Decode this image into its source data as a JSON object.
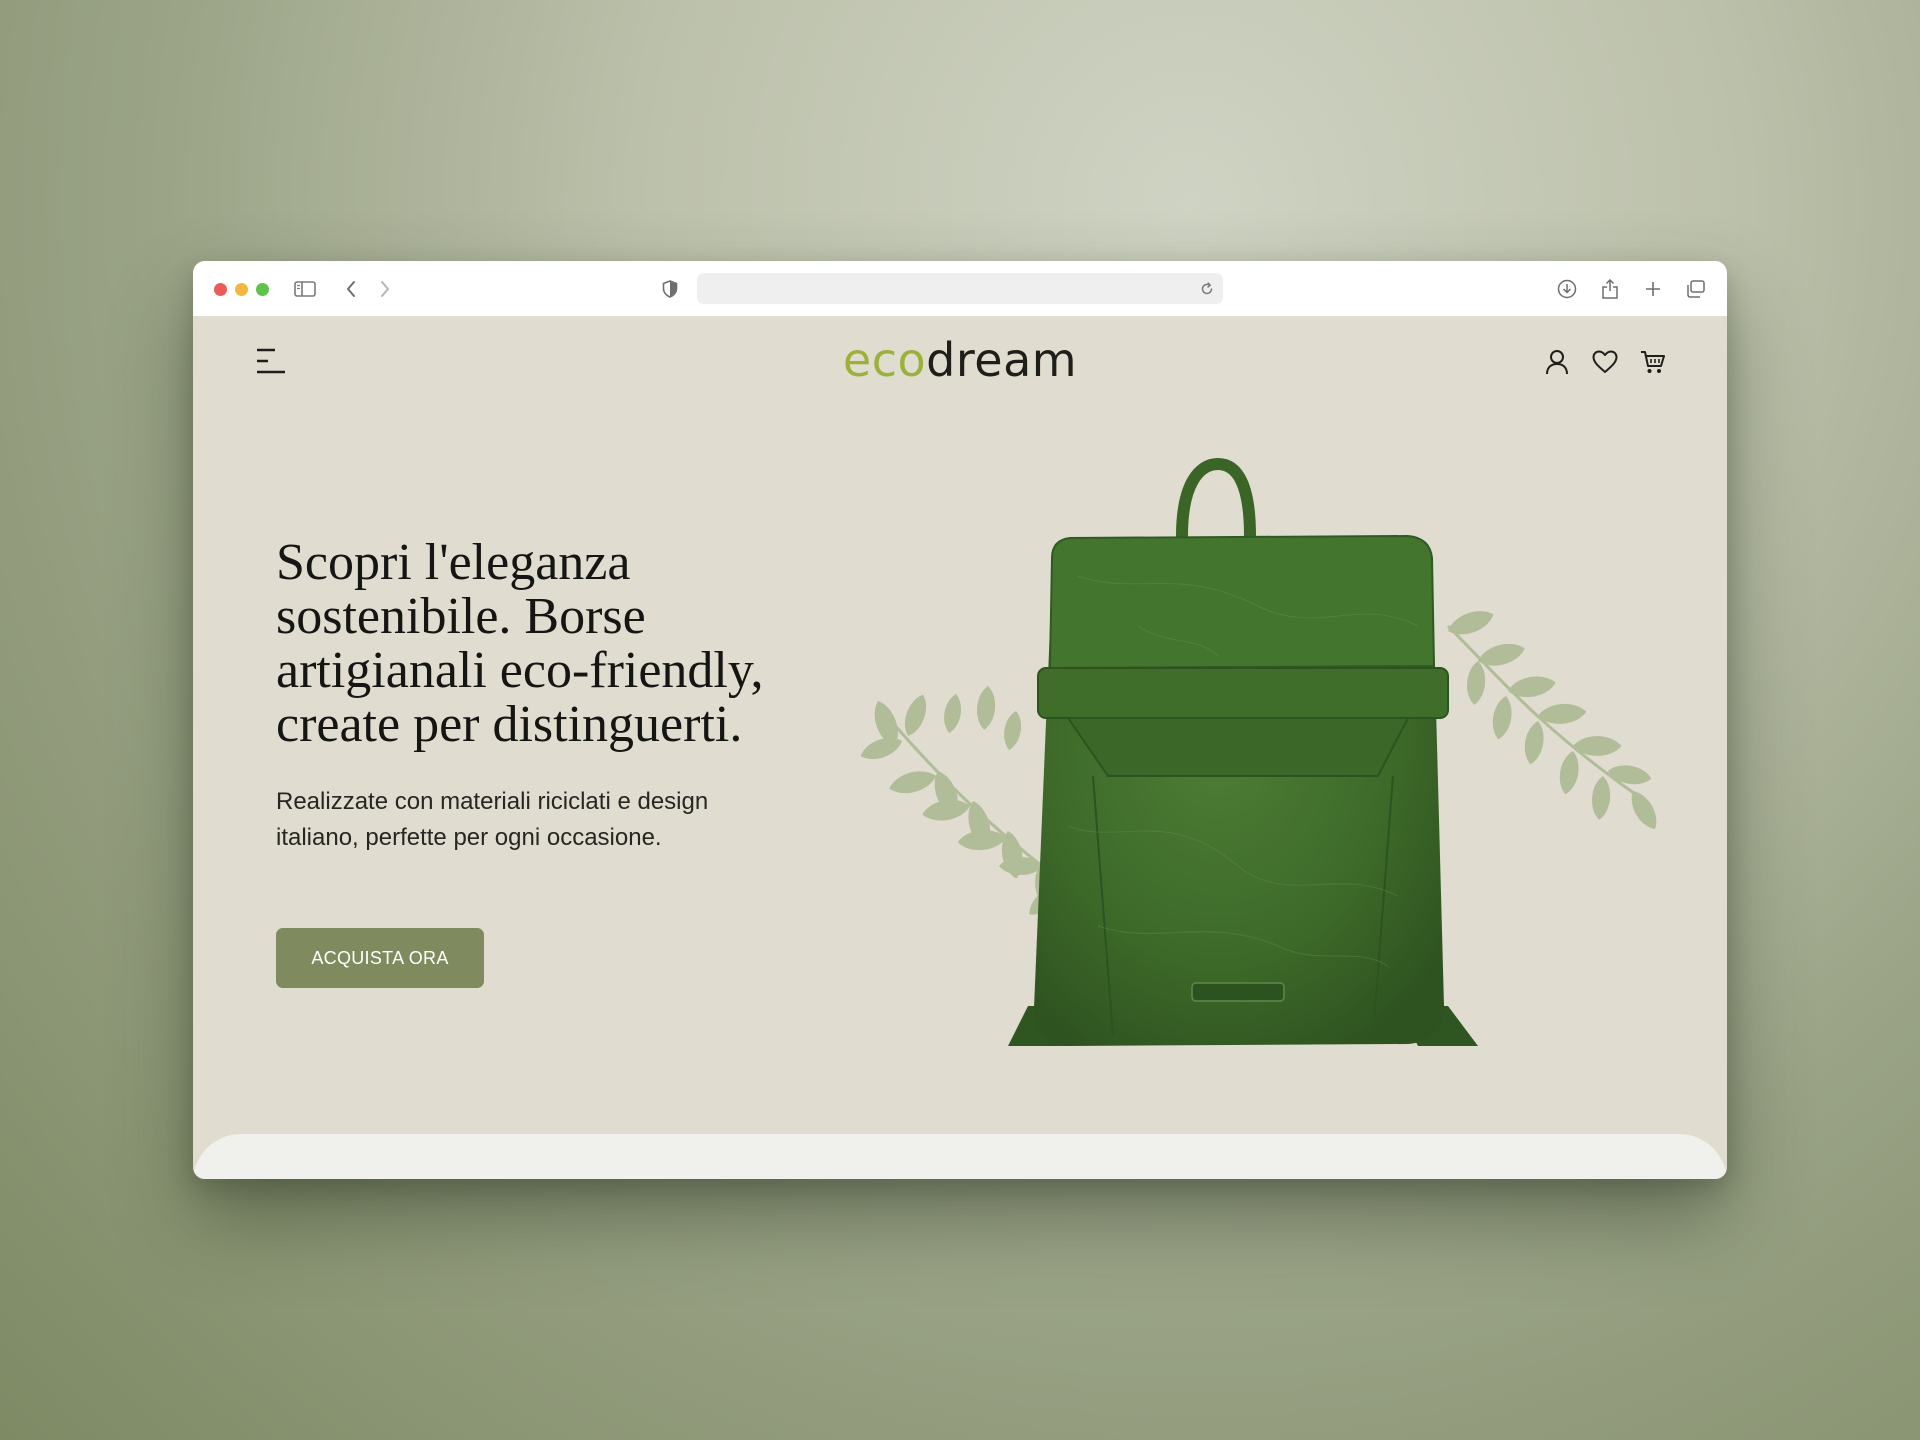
{
  "browser": {
    "address_bar": {
      "value": ""
    },
    "icons": [
      "sidebar-icon",
      "back-icon",
      "forward-icon",
      "shield-icon",
      "reload-icon",
      "download-icon",
      "share-icon",
      "new-tab-icon",
      "tabs-overview-icon"
    ]
  },
  "header": {
    "logo_eco": "eco",
    "logo_dream": "dream",
    "icons": [
      "menu-icon",
      "account-icon",
      "wishlist-heart-icon",
      "cart-icon"
    ]
  },
  "hero": {
    "headline": "Scopri l'eleganza sostenibile. Borse artigianali eco-friendly, create per distinguerti.",
    "subtitle": "Realizzate con materiali riciclati e design italiano, perfette per ogni occasione.",
    "cta_label": "ACQUISTA ORA",
    "image": "green-leather-backpack-with-leaves"
  },
  "colors": {
    "page_background": "#e1dcd0",
    "logo_eco": "#9bb13a",
    "logo_dream": "#1e1e1a",
    "cta_background": "#7f8b5e",
    "backpack": "#3f6b2a",
    "leaves": "#b1bc98",
    "bottom_card": "#f0f0ec"
  }
}
